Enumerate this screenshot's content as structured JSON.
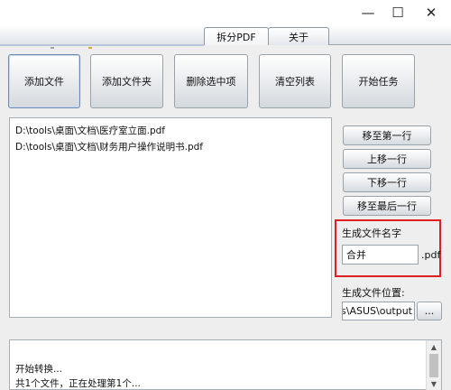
{
  "window": {
    "minimize_glyph": "—",
    "maximize_glyph": "☐",
    "close_glyph": "✕"
  },
  "tabs": [
    {
      "label": "拆分PDF"
    },
    {
      "label": "关于"
    }
  ],
  "toolbar": {
    "add_file": "添加文件",
    "add_folder": "添加文件夹",
    "delete_selected": "删除选中项",
    "clear_list": "清空列表",
    "start_task": "开始任务"
  },
  "file_list": {
    "items": [
      "D:\\tools\\桌面\\文档\\医疗室立面.pdf",
      "D:\\tools\\桌面\\文档\\财务用户操作说明书.pdf"
    ]
  },
  "side_buttons": {
    "move_top": "移至第一行",
    "move_up": "上移一行",
    "move_down": "下移一行",
    "move_bottom": "移至最后一行"
  },
  "output_name": {
    "label": "生成文件名字",
    "value": "合并",
    "extension": ".pdf"
  },
  "output_location": {
    "label": "生成文件位置:",
    "value": "ers\\ASUS\\output",
    "browse_label": "..."
  },
  "log": {
    "lines": [
      "开始转换...",
      "共1个文件，正在处理第1个..."
    ]
  },
  "scrollbar": {
    "up_glyph": "▲",
    "down_glyph": "▼"
  }
}
